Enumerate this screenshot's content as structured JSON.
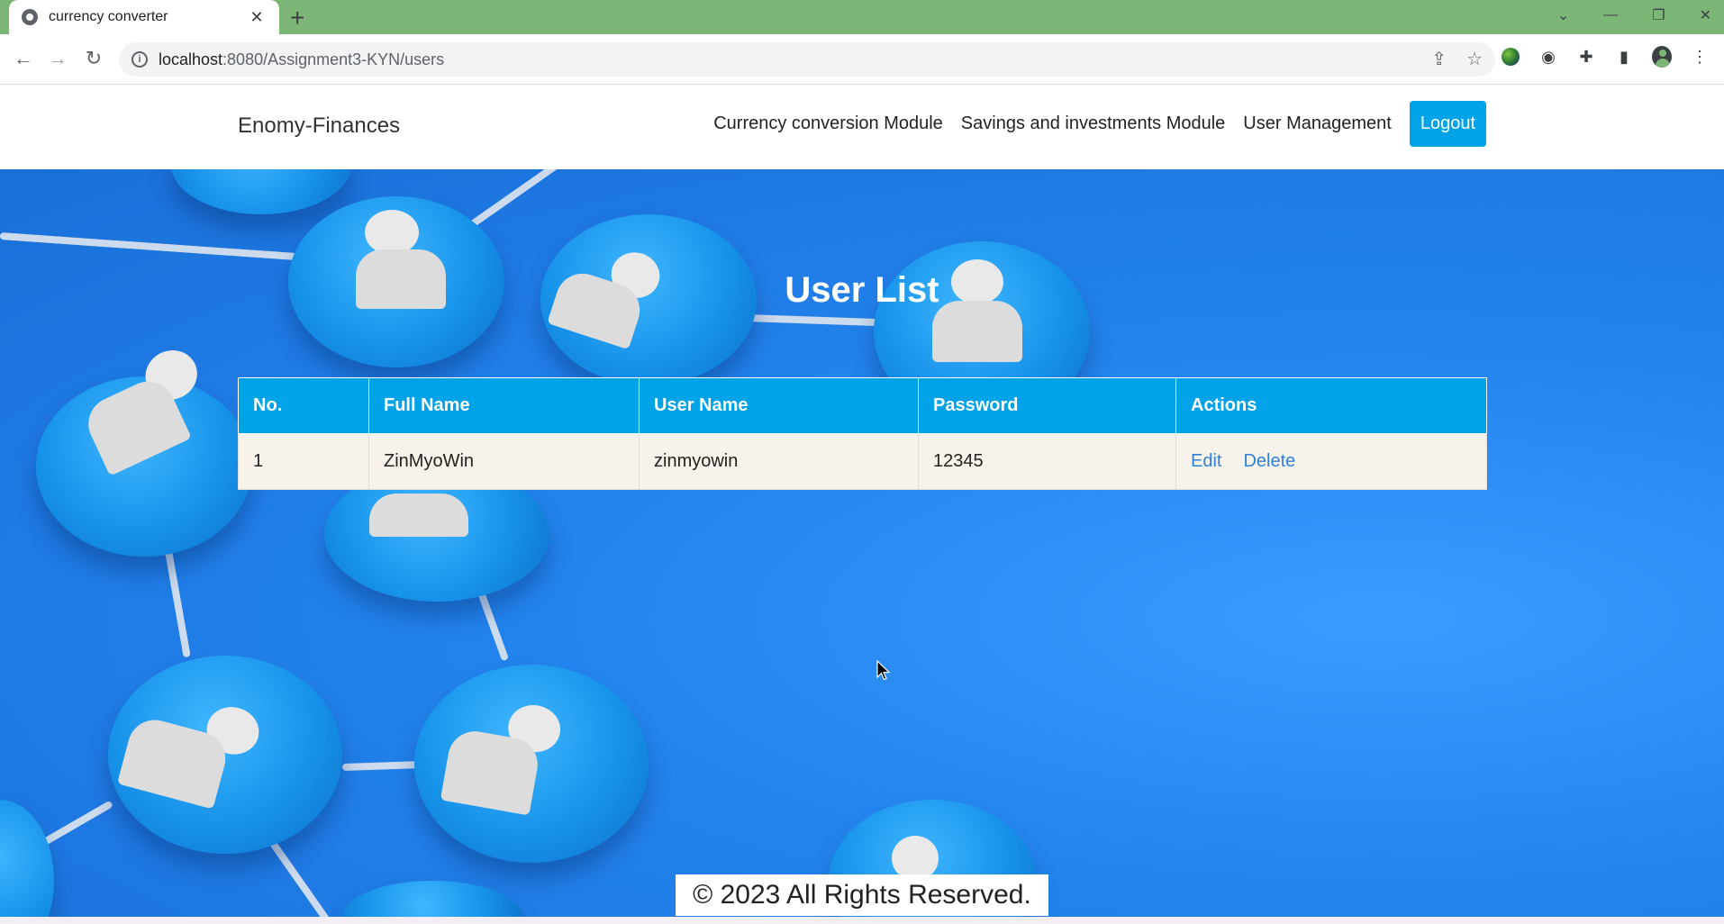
{
  "browser": {
    "tab_title": "currency converter",
    "url_host": "localhost",
    "url_path": ":8080/Assignment3-KYN/users",
    "window_controls": [
      "chevron-down-icon",
      "minimize-icon",
      "restore-icon",
      "close-icon"
    ]
  },
  "navbar": {
    "brand": "Enomy-Finances",
    "links": {
      "currency": "Currency conversion Module",
      "savings": "Savings and investments Module",
      "users": "User Management"
    },
    "logout": "Logout"
  },
  "main": {
    "title": "User List",
    "table": {
      "headers": [
        "No.",
        "Full Name",
        "User Name",
        "Password",
        "Actions"
      ],
      "rows": [
        {
          "no": "1",
          "full_name": "ZinMyoWin",
          "user_name": "zinmyowin",
          "password": "12345",
          "edit": "Edit",
          "delete": "Delete"
        }
      ]
    }
  },
  "footer": {
    "text": "© 2023 All Rights Reserved."
  },
  "colors": {
    "accent": "#00a2e8",
    "tab_strip": "#7cb676",
    "link": "#2f80d8",
    "row_bg": "#f7f3ea"
  }
}
